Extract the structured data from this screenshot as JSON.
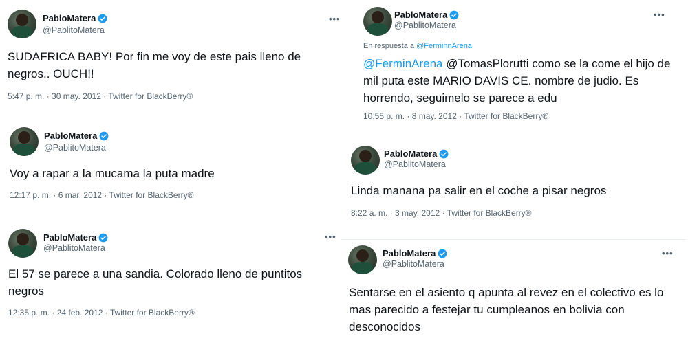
{
  "author": {
    "name": "PabloMatera",
    "handle": "@PablitoMatera"
  },
  "more_label": "•••",
  "tweets": {
    "t1": {
      "text": "SUDAFRICA BABY! Por fin me voy de este pais lleno de negros..   OUCH!!",
      "time": "5:47 p. m.",
      "date": "30 may. 2012",
      "source": "Twitter for BlackBerry®"
    },
    "t2": {
      "text": "Voy a rapar a la mucama la puta madre",
      "time": "12:17 p. m.",
      "date": "6 mar. 2012",
      "source": "Twitter for BlackBerry®"
    },
    "t3": {
      "text": "El 57 se parece a una sandia. Colorado lleno de puntitos negros",
      "time": "12:35 p. m.",
      "date": "24 feb. 2012",
      "source": "Twitter for BlackBerry®"
    },
    "t4": {
      "reply_prefix": "En respuesta a",
      "reply_to": "@FerminnArena",
      "mention": "@FerminArena",
      "text": " @TomasPlorutti como se la come el hijo de mil puta este MARIO DAVIS CE. nombre de judio. Es horrendo, seguimelo se parece a edu",
      "time": "10:55 p. m.",
      "date": "8 may. 2012",
      "source": "Twitter for BlackBerry®"
    },
    "t5": {
      "text": "Linda manana pa salir en el coche a pisar negros",
      "time": "8:22 a. m.",
      "date": "3 may. 2012",
      "source": "Twitter for BlackBerry®"
    },
    "t6": {
      "text": "Sentarse en el asiento q apunta al revez en el colectivo es lo mas parecido a festejar tu cumpleanos en bolivia con desconocidos"
    }
  }
}
